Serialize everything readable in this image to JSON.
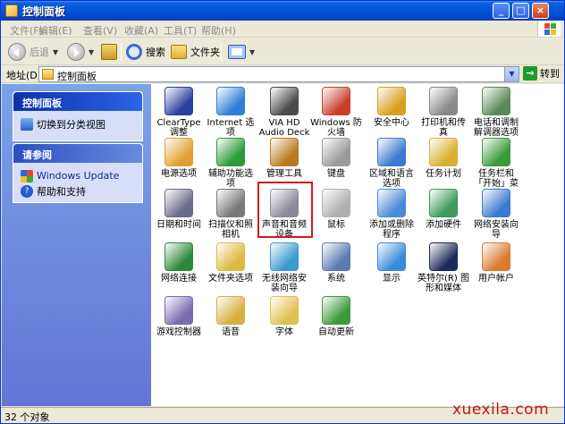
{
  "window": {
    "title": "控制面板"
  },
  "title_buttons": {
    "minimize": "_",
    "maximize": "□",
    "close": "×"
  },
  "menu": [
    "文件(F)",
    "编辑(E)",
    "查看(V)",
    "收藏(A)",
    "工具(T)",
    "帮助(H)"
  ],
  "toolbar": {
    "back": "后退",
    "search": "搜索",
    "folders": "文件夹"
  },
  "address": {
    "label": "地址(D)",
    "value": "控制面板",
    "go": "转到"
  },
  "left_panels": {
    "panel1": {
      "title": "控制面板",
      "items": [
        "切换到分类视图"
      ]
    },
    "panel2": {
      "title": "请参阅",
      "items": [
        "Windows Update",
        "帮助和支持"
      ]
    }
  },
  "items": [
    {
      "label": "ClearType 调整",
      "icon": "cleartype-icon",
      "color": "#2b3f9e"
    },
    {
      "label": "Internet 选项",
      "icon": "internet-options-icon",
      "color": "#2f7fd8"
    },
    {
      "label": "VIA HD Audio Deck",
      "icon": "via-audio-deck-icon",
      "color": "#4a4a4a"
    },
    {
      "label": "Windows 防火墙",
      "icon": "firewall-icon",
      "color": "#c8402a"
    },
    {
      "label": "安全中心",
      "icon": "security-center-icon",
      "color": "#d8a020"
    },
    {
      "label": "打印机和传真",
      "icon": "printer-icon",
      "color": "#8a8a8a"
    },
    {
      "label": "电话和调制解调器选项",
      "icon": "phone-modem-icon",
      "color": "#5a8a5a"
    },
    {
      "label": "电源选项",
      "icon": "power-options-icon",
      "color": "#e0a030"
    },
    {
      "label": "辅助功能选项",
      "icon": "accessibility-icon",
      "color": "#2a9a3a"
    },
    {
      "label": "管理工具",
      "icon": "admin-tools-icon",
      "color": "#b87a20"
    },
    {
      "label": "键盘",
      "icon": "keyboard-icon",
      "color": "#9a9a9a"
    },
    {
      "label": "区域和语言选项",
      "icon": "region-language-icon",
      "color": "#3a7ad0"
    },
    {
      "label": "任务计划",
      "icon": "scheduled-tasks-icon",
      "color": "#d8b030"
    },
    {
      "label": "任务栏和「开始」菜单",
      "icon": "taskbar-start-icon",
      "color": "#3a9a3a"
    },
    {
      "label": "日期和时间",
      "icon": "date-time-icon",
      "color": "#6a6a8a"
    },
    {
      "label": "扫描仪和照相机",
      "icon": "scanner-camera-icon",
      "color": "#7a7a7a"
    },
    {
      "label": "声音和音频设备",
      "icon": "sound-audio-icon",
      "color": "#8a8a9a"
    },
    {
      "label": "鼠标",
      "icon": "mouse-icon",
      "color": "#b0b0b0"
    },
    {
      "label": "添加或删除程序",
      "icon": "add-remove-programs-icon",
      "color": "#4a8ad8"
    },
    {
      "label": "添加硬件",
      "icon": "add-hardware-icon",
      "color": "#3a9a5a"
    },
    {
      "label": "网络安装向导",
      "icon": "network-setup-icon",
      "color": "#3a7ad0"
    },
    {
      "label": "网络连接",
      "icon": "network-connections-icon",
      "color": "#2a8a3a"
    },
    {
      "label": "文件夹选项",
      "icon": "folder-options-icon",
      "color": "#e0b840"
    },
    {
      "label": "无线网络安装向导",
      "icon": "wireless-setup-icon",
      "color": "#3a9ad0"
    },
    {
      "label": "系统",
      "icon": "system-icon",
      "color": "#5a7ab0"
    },
    {
      "label": "显示",
      "icon": "display-icon",
      "color": "#3a8ad8"
    },
    {
      "label": "英特尔(R) 图形和媒体",
      "icon": "intel-graphics-icon",
      "color": "#1a2a5a"
    },
    {
      "label": "用户帐户",
      "icon": "user-accounts-icon",
      "color": "#d87a30"
    },
    {
      "label": "游戏控制器",
      "icon": "game-controller-icon",
      "color": "#7a6ab0"
    },
    {
      "label": "语音",
      "icon": "speech-icon",
      "color": "#d8b040"
    },
    {
      "label": "字体",
      "icon": "fonts-icon",
      "color": "#e0c050"
    },
    {
      "label": "自动更新",
      "icon": "auto-update-icon",
      "color": "#3a9a3a"
    }
  ],
  "status": {
    "text": "32 个对象"
  },
  "watermark": "xuexila.com"
}
